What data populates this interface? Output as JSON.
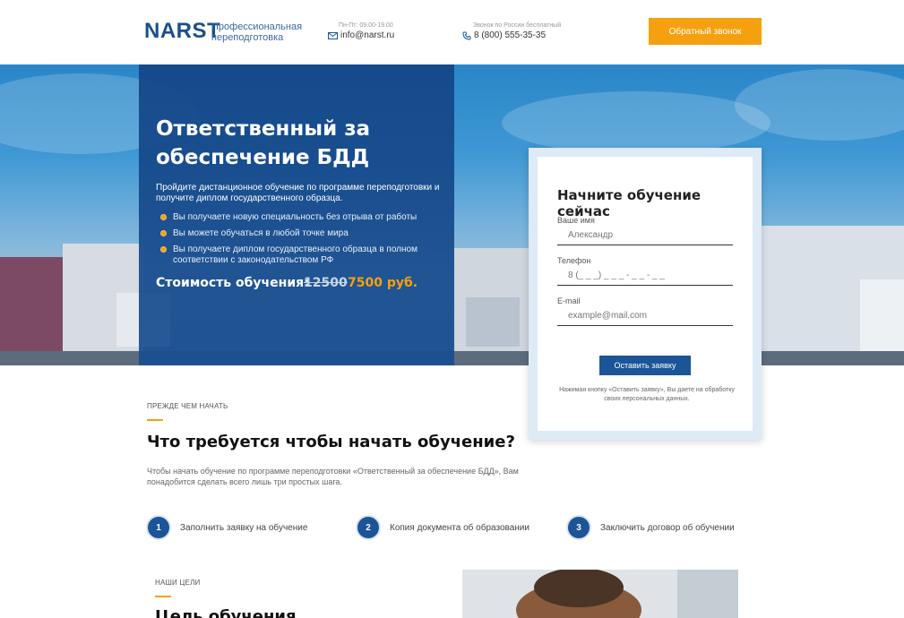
{
  "header": {
    "logo": "NARST",
    "tagline": "Профессиональная переподготовка",
    "hours_label": "Пн-Пт: 09.00-19.00",
    "email": "info@narst.ru",
    "free_call_label": "Звонок по России бесплатный",
    "phone": "8 (800) 555-35-35",
    "callback_button": "Обратный звонок"
  },
  "hero": {
    "title": "Ответственный за обеспечение БДД",
    "subtitle": "Пройдите дистанционное обучение по программе переподготовки и получите диплом государственного образца.",
    "bullets": [
      "Вы получаете новую специальность без отрыва от работы",
      "Вы можете обучаться в любой точке мира",
      "Вы получаете диплом государственного образца в полном соответствии с законодательством РФ"
    ],
    "price_label": "Стоимость обучения:",
    "price_old": "12500",
    "price_new": "7500 руб."
  },
  "form": {
    "title": "Начните обучение сейчас",
    "name_label": "Ваше имя",
    "name_placeholder": "Александр",
    "phone_label": "Телефон",
    "phone_placeholder": "8 (_ _ _) _ _ _ - _ _ - _ _",
    "email_label": "E-mail",
    "email_placeholder": "example@mail.com",
    "submit": "Оставить заявку",
    "note": "Нажимая кнопку «Оставить заявку», Вы даете на обработку своих персональных данных."
  },
  "before_start": {
    "eyebrow": "ПРЕЖДЕ ЧЕМ НАЧАТЬ",
    "title": "Что требуется чтобы начать обучение?",
    "description": "Чтобы начать обучение по программе переподготовки «Ответственный за обеспечение БДД», Вам понадобится сделать всего лишь три простых шага.",
    "steps": [
      {
        "num": "1",
        "label": "Заполнить заявку на обучение"
      },
      {
        "num": "2",
        "label": "Копия документа об образовании"
      },
      {
        "num": "3",
        "label": "Заключить договор об обучении"
      }
    ]
  },
  "goals": {
    "eyebrow": "НАШИ ЦЕЛИ",
    "title": "Цель обучения"
  },
  "colors": {
    "brand_blue": "#1c5597",
    "accent_orange": "#f5a00f"
  }
}
